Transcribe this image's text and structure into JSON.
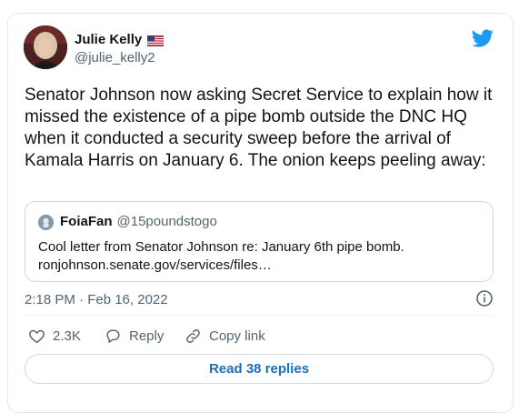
{
  "author": {
    "display_name": "Julie Kelly",
    "handle": "@julie_kelly2",
    "flag": "us-flag-icon"
  },
  "tweet": {
    "text": "Senator Johnson now asking Secret Service to explain how it missed the existence of a pipe bomb outside the DNC HQ when it conducted a security sweep before the arrival of Kamala Harris on January 6. The onion keeps peeling away:",
    "timestamp": "2:18 PM · Feb 16, 2022"
  },
  "quote": {
    "name": "FoiaFan",
    "handle": "@15poundstogo",
    "text_line1": "Cool letter from Senator Johnson re: January 6th pipe bomb.",
    "text_line2": "ronjohnson.senate.gov/services/files…"
  },
  "actions": {
    "like_count": "2.3K",
    "reply_label": "Reply",
    "copy_link_label": "Copy link"
  },
  "replies_button": "Read 38 replies",
  "colors": {
    "brand": "#1d9bf0",
    "link": "#1d6fb8",
    "secondary_text": "#536471"
  }
}
